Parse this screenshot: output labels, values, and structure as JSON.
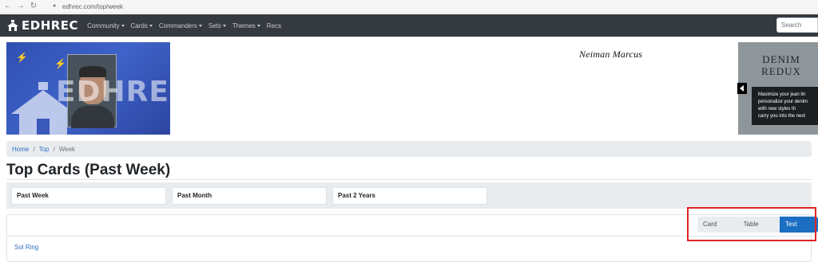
{
  "browser": {
    "url": "edhrec.com/top/week",
    "nav_icons": [
      "back-icon",
      "forward-icon",
      "reload-icon",
      "lock-icon"
    ]
  },
  "navbar": {
    "brand": "EDHREC",
    "menu": [
      "Community",
      "Cards",
      "Commanders",
      "Sets",
      "Themes",
      "Recs"
    ],
    "search_placeholder": "Search"
  },
  "banner": {
    "logo_word": "EDHREC"
  },
  "ads": {
    "neiman": {
      "logo": "Neiman Marcus"
    },
    "denim": {
      "title_line1": "DENIM",
      "title_line2": "REDUX",
      "copy": [
        "Maximize your jean lin",
        "personalize your denim",
        "with new styles th",
        "carry you into the next"
      ]
    }
  },
  "breadcrumb": {
    "home": "Home",
    "top": "Top",
    "current": "Week"
  },
  "page": {
    "title": "Top Cards (Past Week)"
  },
  "ranges": [
    "Past Week",
    "Past Month",
    "Past 2 Years"
  ],
  "view_toggle": {
    "options": [
      "Card View",
      "Table View",
      "Text View"
    ],
    "active": "Text View"
  },
  "results": {
    "items": [
      "Sol Ring"
    ]
  },
  "colors": {
    "navbar": "#343a40",
    "link": "#2f6dc0",
    "active_button": "#1b6ec2",
    "highlight": "#e02424"
  }
}
